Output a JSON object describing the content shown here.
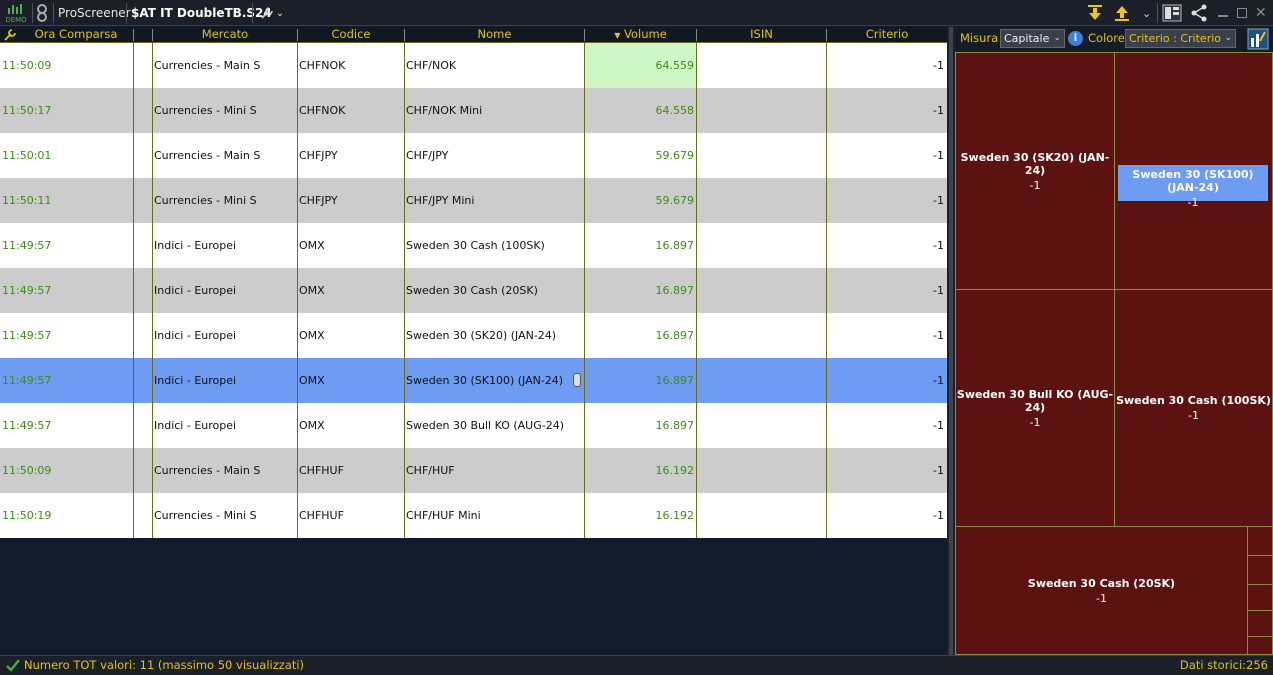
{
  "toolbar": {
    "demo_label": "DEMO",
    "app_name": "ProScreener",
    "screener_name": "$AT IT DoubleTB.S24"
  },
  "grid": {
    "columns": [
      "Ora Comparsa",
      "Mercato",
      "Codice",
      "Nome",
      "Volume",
      "ISIN",
      "Criterio"
    ],
    "sorted_column": "Volume",
    "rows": [
      {
        "time": "11:50:09",
        "market": "Currencies - Main S",
        "code": "CHFNOK",
        "name": "CHF/NOK",
        "volume": "64.559",
        "isin": "",
        "criterio": "-1"
      },
      {
        "time": "11:50:17",
        "market": "Currencies - Mini S",
        "code": "CHFNOK",
        "name": "CHF/NOK Mini",
        "volume": "64.558",
        "isin": "",
        "criterio": "-1"
      },
      {
        "time": "11:50:01",
        "market": "Currencies - Main S",
        "code": "CHFJPY",
        "name": "CHF/JPY",
        "volume": "59.679",
        "isin": "",
        "criterio": "-1"
      },
      {
        "time": "11:50:11",
        "market": "Currencies - Mini S",
        "code": "CHFJPY",
        "name": "CHF/JPY Mini",
        "volume": "59.679",
        "isin": "",
        "criterio": "-1"
      },
      {
        "time": "11:49:57",
        "market": "Indici - Europei",
        "code": "OMX",
        "name": "Sweden 30 Cash (100SK)",
        "volume": "16.897",
        "isin": "",
        "criterio": "-1"
      },
      {
        "time": "11:49:57",
        "market": "Indici - Europei",
        "code": "OMX",
        "name": "Sweden 30 Cash (20SK)",
        "volume": "16.897",
        "isin": "",
        "criterio": "-1"
      },
      {
        "time": "11:49:57",
        "market": "Indici - Europei",
        "code": "OMX",
        "name": "Sweden 30 (SK20) (JAN-24)",
        "volume": "16.897",
        "isin": "",
        "criterio": "-1"
      },
      {
        "time": "11:49:57",
        "market": "Indici - Europei",
        "code": "OMX",
        "name": "Sweden 30 (SK100) (JAN-24)",
        "volume": "16.897",
        "isin": "",
        "criterio": "-1"
      },
      {
        "time": "11:49:57",
        "market": "Indici - Europei",
        "code": "OMX",
        "name": "Sweden 30 Bull KO (AUG-24)",
        "volume": "16.897",
        "isin": "",
        "criterio": "-1"
      },
      {
        "time": "11:50:09",
        "market": "Currencies - Main S",
        "code": "CHFHUF",
        "name": "CHF/HUF",
        "volume": "16.192",
        "isin": "",
        "criterio": "-1"
      },
      {
        "time": "11:50:19",
        "market": "Currencies - Mini S",
        "code": "CHFHUF",
        "name": "CHF/HUF Mini",
        "volume": "16.192",
        "isin": "",
        "criterio": "-1"
      }
    ],
    "selected_row_index": 7
  },
  "right_panel": {
    "misura_label": "Misura",
    "misura_value": "Capitale",
    "colore_label": "Colore",
    "colore_value": "Criterio : Criterio",
    "tiles": [
      {
        "name": "Sweden 30 (SK20) (JAN-24)",
        "value": "-1"
      },
      {
        "name": "Sweden 30 (SK100) (JAN-24)",
        "value": "-1"
      },
      {
        "name": "Sweden 30 Bull KO (AUG-24)",
        "value": "-1"
      },
      {
        "name": "Sweden 30 Cash (100SK)",
        "value": "-1"
      },
      {
        "name": "Sweden 30 Cash (20SK)",
        "value": "-1"
      }
    ]
  },
  "status": {
    "left": "Numero TOT valori: 11 (massimo 50 visualizzati)",
    "right": "Dati storici:256"
  },
  "colors": {
    "accent_yellow": "#e3c21a",
    "time_green": "#3c8d13",
    "selected_blue": "#6e9cf2",
    "tile_red": "#5d1212"
  }
}
